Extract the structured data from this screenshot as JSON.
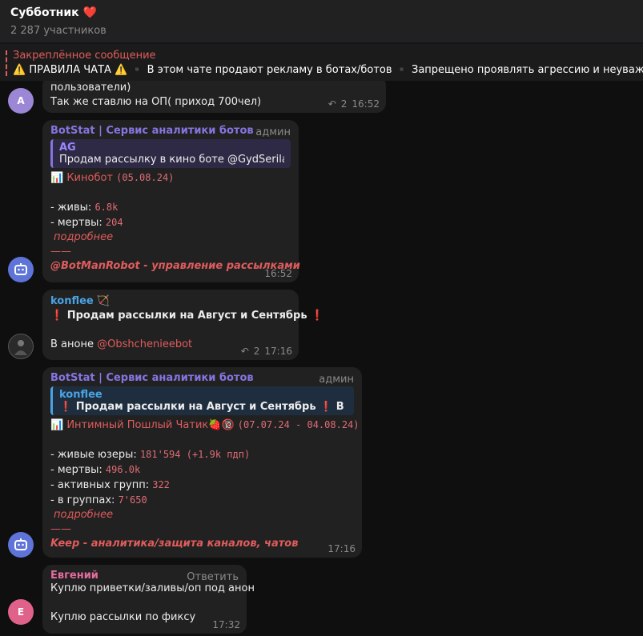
{
  "header": {
    "title": "Субботник",
    "title_emoji": "❤️",
    "subtitle": "2 287 участников"
  },
  "pinned": {
    "title": "Закреплённое сообщение",
    "text": "⚠️ ПРАВИЛА ЧАТА ⚠️   ▪️ В этом чате продают рекламу в ботах/ботов   ▪️ Запрещено проявлять агрессию и неуважение к др"
  },
  "messages": [
    {
      "avatar_letter": "A",
      "lines": [
        "пользователи)",
        "Так же ставлю на ОП( приход 700чел)"
      ],
      "replies": "2",
      "time": "16:52"
    },
    {
      "sender": "BotStat | Сервис аналитики ботов",
      "role": "админ",
      "quote_name": "AG",
      "quote_text": "Продам рассылку в кино боте @GydSerilasB...",
      "bot_emoji": "📊",
      "bot_name": "Кинобот",
      "bot_date": "(05.08.24)",
      "alive_label": "- живы:",
      "alive_value": "6.8k",
      "dead_label": "- мертвы:",
      "dead_value": "204",
      "more": "подробнее",
      "dash": "——",
      "footer": "@BotManRobot - управление рассылками",
      "time": "16:52"
    },
    {
      "sender": "konflee",
      "sender_emoji": "🏹",
      "line1": "❗ Продам рассылки на Август и Сентябрь ❗",
      "line2_prefix": "В аноне",
      "line2_link": "@Obshchenieebot",
      "replies": "2",
      "time": "17:16"
    },
    {
      "sender": "BotStat | Сервис аналитики ботов",
      "role": "админ",
      "quote_name": "konflee",
      "quote_text": "❗ Продам рассылки на Август и Сентябрь ❗   В анон...",
      "bot_emoji": "📊",
      "bot_name": "Интимный Пошлый Чатик🍓🔞",
      "bot_date": "(07.07.24 - 04.08.24)",
      "l1_label": "- живые юзеры:",
      "l1_value": "181'594 (+1.9k пдп)",
      "l2_label": "- мертвы:",
      "l2_value": "496.0k",
      "l3_label": "- активных групп:",
      "l3_value": "322",
      "l4_label": "- в группах:",
      "l4_value": "7'650",
      "more": "подробнее",
      "dash": "——",
      "footer": "Keep - аналитика/защита каналов, чатов",
      "time": "17:16"
    },
    {
      "avatar_letter": "E",
      "sender": "Евгений",
      "reply_label": "Ответить",
      "line1": "Куплю приветки/заливы/оп под анон",
      "line2": "Куплю рассылки по фиксу",
      "time": "17:32"
    }
  ],
  "colors": {
    "background": "#0f0f0f",
    "bubble": "#212121",
    "accent_purple": "#8774e1",
    "accent_blue": "#4aa3e3",
    "accent_red": "#e05c5c"
  }
}
